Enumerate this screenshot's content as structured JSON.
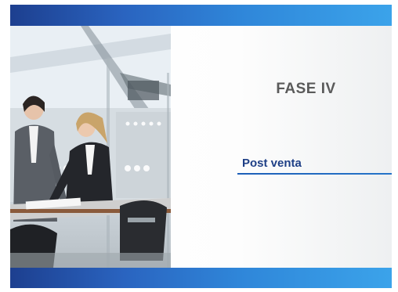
{
  "slide": {
    "title": "FASE IV",
    "subtitle": "Post venta",
    "photo_description_name": "office-meeting-photo"
  },
  "colors": {
    "bar_dark": "#1d3f8f",
    "bar_light": "#3ba3ea",
    "title_gray": "#5a5a5a",
    "subtitle_blue": "#1e3f86",
    "rule_blue": "#1d5fb8"
  }
}
